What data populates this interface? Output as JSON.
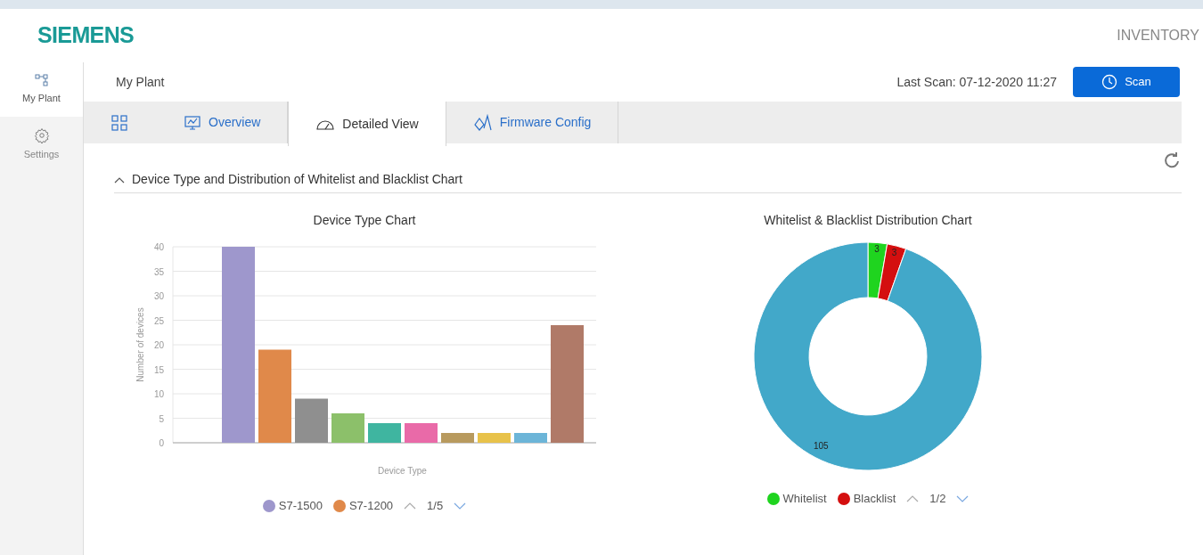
{
  "header": {
    "logo": "SIEMENS",
    "app_name": "INVENTORY"
  },
  "sidebar": {
    "items": [
      {
        "label": "My Plant",
        "selected": true
      },
      {
        "label": "Settings",
        "selected": false
      }
    ]
  },
  "page": {
    "title": "My Plant",
    "last_scan": "Last Scan: 07-12-2020 11:27",
    "scan_button": "Scan"
  },
  "tabs": [
    {
      "selected": false
    },
    {
      "label": "Overview",
      "selected": false
    },
    {
      "label": "Detailed View",
      "selected": true
    },
    {
      "label": "Firmware Config",
      "selected": false
    }
  ],
  "section": {
    "title": "Device Type and Distribution of Whitelist and Blacklist Chart",
    "expanded": true
  },
  "bar_chart": {
    "chart_data": {
      "type": "bar",
      "title": "Device Type Chart",
      "xlabel": "Device Type",
      "ylabel": "Number of devices",
      "values": [
        40,
        19,
        9,
        6,
        4,
        4,
        2,
        2,
        2,
        24
      ],
      "colors": [
        "#9e97cc",
        "#e0894a",
        "#8f8f8f",
        "#8cc06a",
        "#3fb5a0",
        "#e96aa8",
        "#b89a5e",
        "#e8c24a",
        "#6cb5d8",
        "#b07a68"
      ],
      "ylim": [
        0,
        40
      ],
      "grid": true,
      "yticks": [
        0,
        5,
        10,
        15,
        20,
        25,
        30,
        35,
        40
      ]
    },
    "legend": {
      "items": [
        {
          "label": "S7-1500",
          "color": "#9e97cc"
        },
        {
          "label": "S7-1200",
          "color": "#e0894a"
        }
      ],
      "page": "1/5"
    }
  },
  "donut_chart": {
    "chart_data": {
      "type": "donut",
      "title": "Whitelist & Blacklist Distribution Chart",
      "values": [
        3,
        3,
        105
      ],
      "colors": [
        "#1fd41f",
        "#d40f0f",
        "#42a8c9"
      ],
      "value_labels": [
        "3",
        "3",
        "105"
      ]
    },
    "legend": {
      "items": [
        {
          "label": "Whitelist",
          "color": "#1fd41f"
        },
        {
          "label": "Blacklist",
          "color": "#d40f0f"
        }
      ],
      "page": "1/2"
    }
  }
}
